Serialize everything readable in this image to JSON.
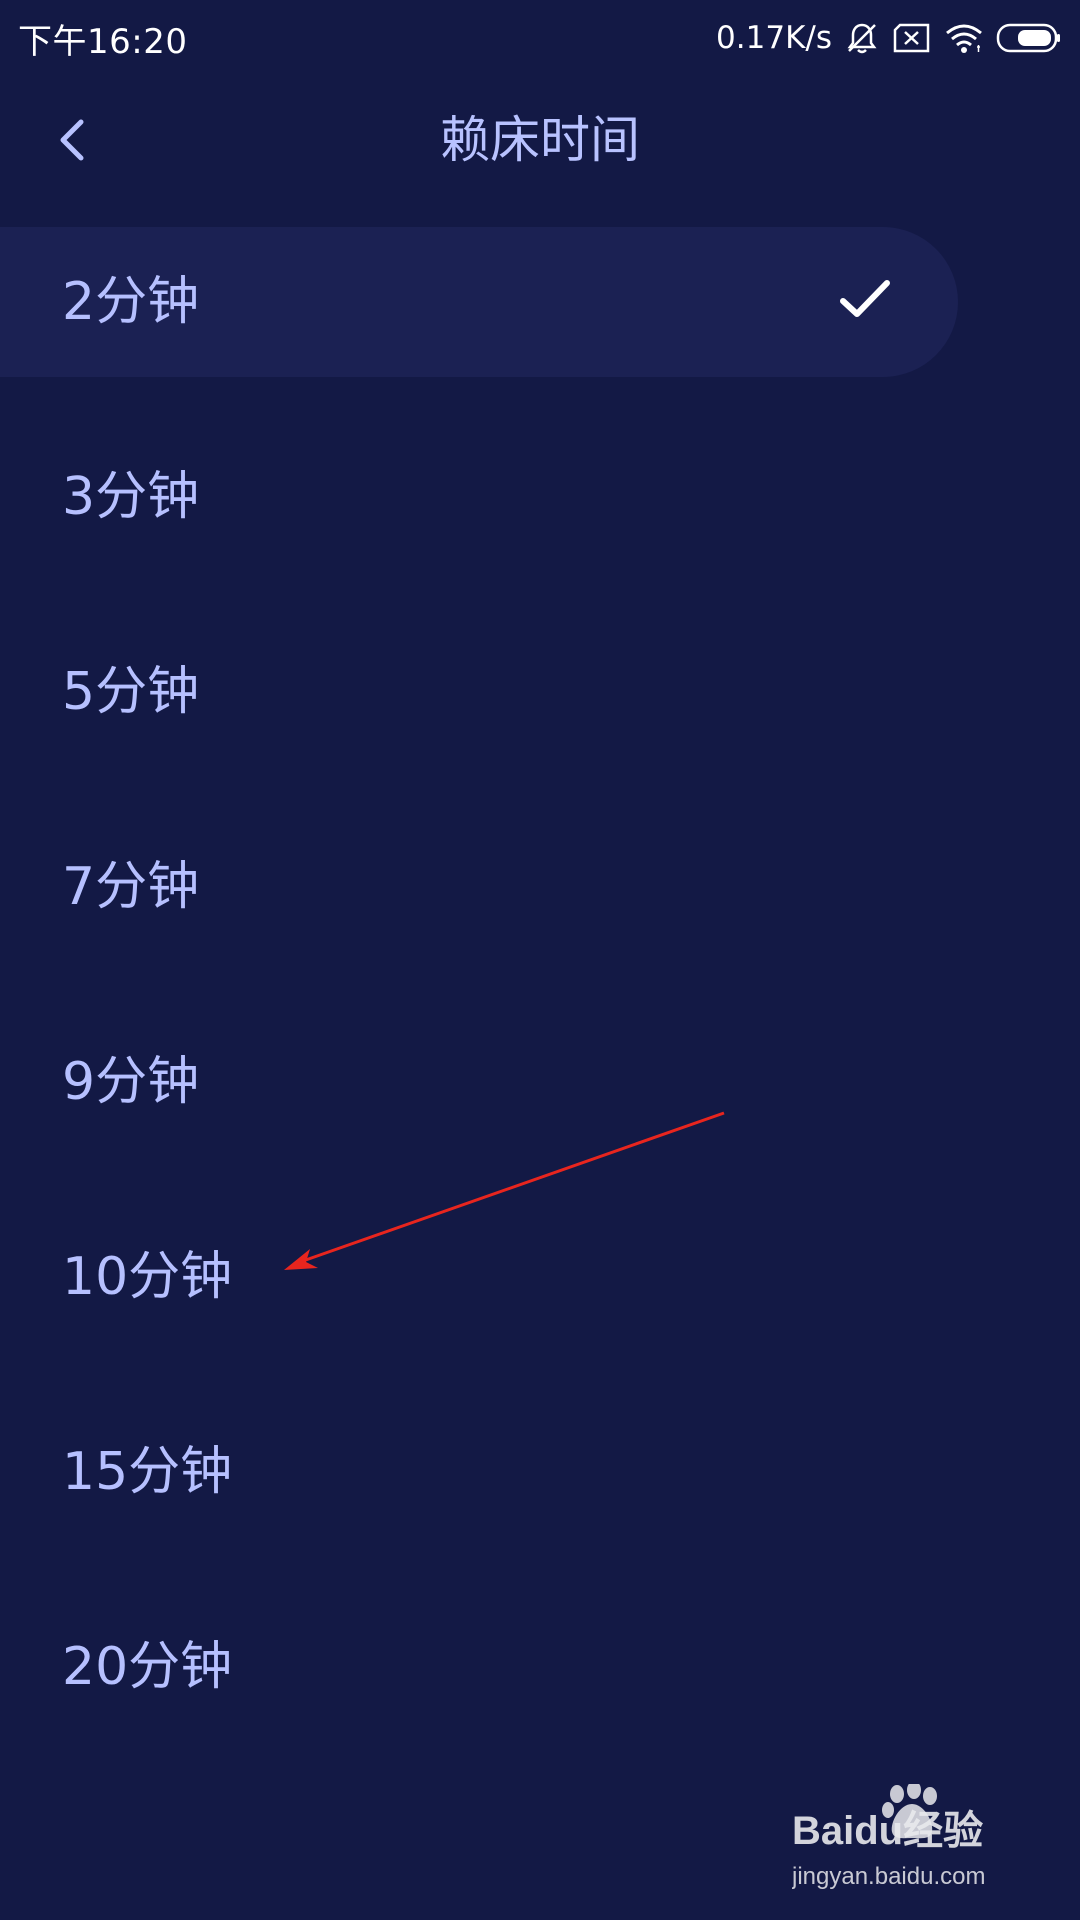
{
  "status_bar": {
    "time": "下午16:20",
    "network_speed": "0.17K/s"
  },
  "header": {
    "title": "赖床时间"
  },
  "options": [
    {
      "label": "2分钟",
      "selected": true
    },
    {
      "label": "3分钟",
      "selected": false
    },
    {
      "label": "5分钟",
      "selected": false
    },
    {
      "label": "7分钟",
      "selected": false
    },
    {
      "label": "9分钟",
      "selected": false
    },
    {
      "label": "10分钟",
      "selected": false
    },
    {
      "label": "15分钟",
      "selected": false
    },
    {
      "label": "20分钟",
      "selected": false
    }
  ],
  "watermark": {
    "brand": "Baidu经验",
    "url": "jingyan.baidu.com"
  },
  "colors": {
    "background": "#131945",
    "selected_row": "#1b2153",
    "text": "#b6c0ff",
    "annotation_arrow": "#e8251e"
  },
  "icons": {
    "back": "chevron-left-icon",
    "check": "checkmark-icon",
    "mute": "bell-off-icon",
    "sim": "sim-x-icon",
    "wifi": "wifi-icon",
    "battery": "battery-icon"
  }
}
